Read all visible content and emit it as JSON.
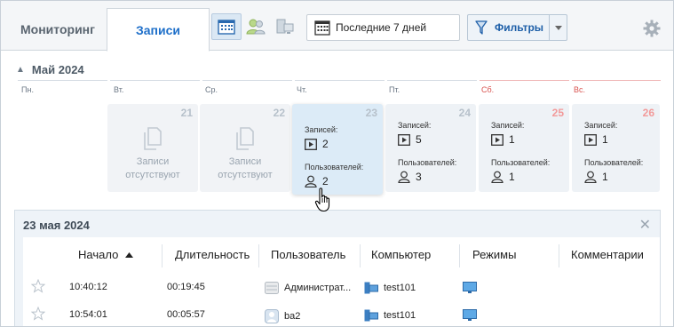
{
  "tabs": [
    {
      "label": "Мониторинг"
    },
    {
      "label": "Записи"
    }
  ],
  "toolbar": {
    "date_range": "Последние 7 дней",
    "filters_label": "Фильтры"
  },
  "calendar": {
    "month": "Май 2024",
    "weekdays": [
      "Пн.",
      "Вт.",
      "Ср.",
      "Чт.",
      "Пт.",
      "Сб.",
      "Вс."
    ],
    "labels": {
      "records": "Записей:",
      "users": "Пользователей:",
      "no_records_line1": "Записи",
      "no_records_line2": "отсутствуют"
    },
    "days": [
      {
        "num": "21",
        "records": "",
        "users": ""
      },
      {
        "num": "22",
        "records": "",
        "users": ""
      },
      {
        "num": "23",
        "records": "2",
        "users": "2"
      },
      {
        "num": "24",
        "records": "5",
        "users": "3"
      },
      {
        "num": "25",
        "records": "1",
        "users": "1"
      },
      {
        "num": "26",
        "records": "1",
        "users": "1"
      }
    ]
  },
  "details": {
    "title": "23 мая 2024",
    "columns": [
      "Начало",
      "Длительность",
      "Пользователь",
      "Компьютер",
      "Режимы",
      "Комментарии"
    ],
    "rows": [
      {
        "start": "10:40:12",
        "duration": "00:19:45",
        "user": "Администрат...",
        "computer": "test101"
      },
      {
        "start": "10:54:01",
        "duration": "00:05:57",
        "user": "ba2",
        "computer": "test101"
      }
    ]
  },
  "colors": {
    "accent": "#1e6fc9",
    "weekend": "#d9534f",
    "selected_card": "#dcebf7"
  }
}
